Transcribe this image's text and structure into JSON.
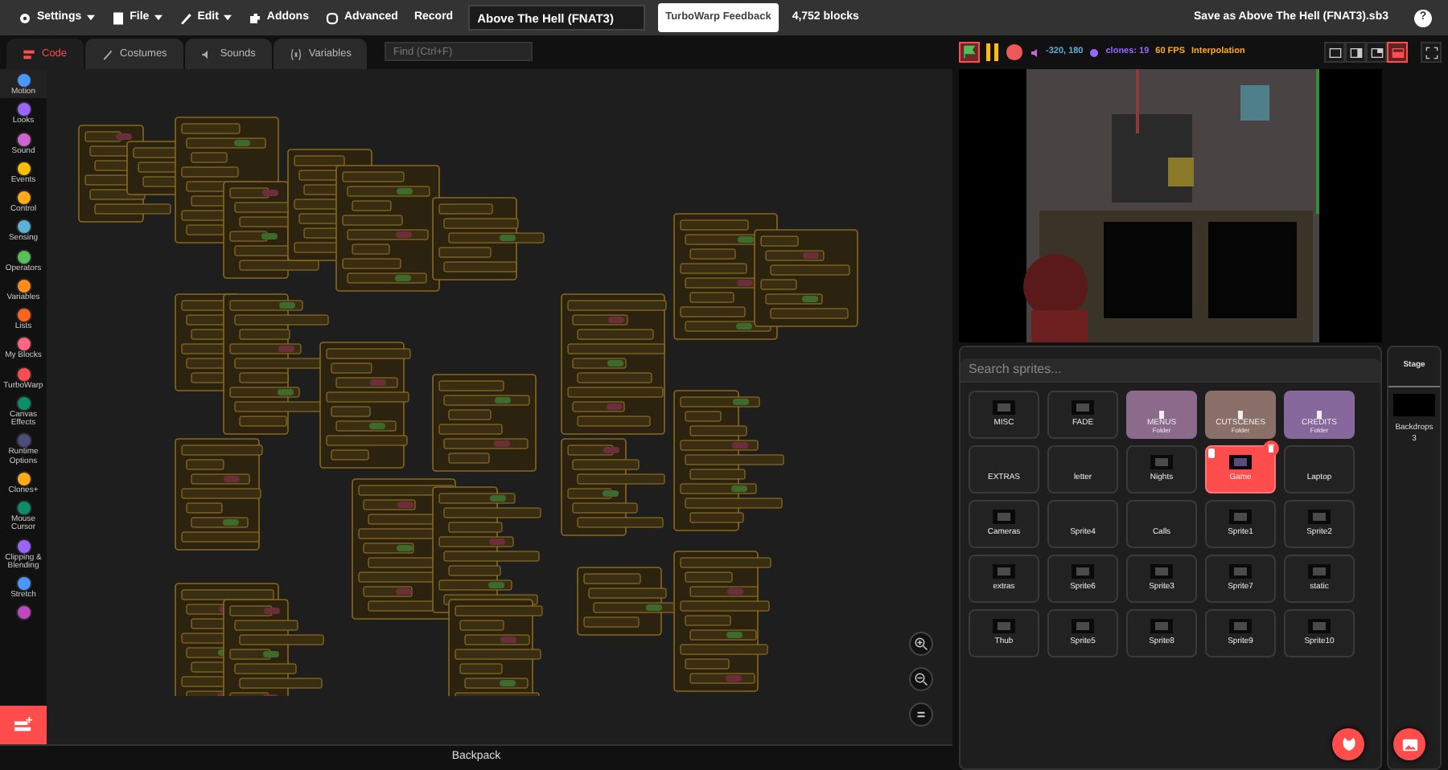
{
  "menu_bar": {
    "items": [
      {
        "label": "Settings",
        "dropdown": true
      },
      {
        "label": "File",
        "dropdown": true
      },
      {
        "label": "Edit",
        "dropdown": true
      },
      {
        "label": "Addons",
        "dropdown": false
      },
      {
        "label": "Advanced",
        "dropdown": false
      },
      {
        "label": "Record",
        "dropdown": false
      }
    ],
    "project_title": "Above The Hell (FNAT3)",
    "feedback_button": "TurboWarp Feedback",
    "block_count": "4,752 blocks",
    "save_label": "Save as Above The Hell (FNAT3).sb3",
    "help": "?"
  },
  "tabs": [
    {
      "label": "Code",
      "selected": true
    },
    {
      "label": "Costumes",
      "selected": false
    },
    {
      "label": "Sounds",
      "selected": false
    },
    {
      "label": "Variables",
      "selected": false
    }
  ],
  "find": {
    "placeholder": "Find (Ctrl+F)"
  },
  "categories": [
    {
      "label": "Motion",
      "color": "#4c97ff",
      "selected": true
    },
    {
      "label": "Looks",
      "color": "#9966ff",
      "selected": false
    },
    {
      "label": "Sound",
      "color": "#cf63cf",
      "selected": false
    },
    {
      "label": "Events",
      "color": "#ffbf00",
      "selected": false
    },
    {
      "label": "Control",
      "color": "#ffab19",
      "selected": false
    },
    {
      "label": "Sensing",
      "color": "#5cb1d6",
      "selected": false
    },
    {
      "label": "Operators",
      "color": "#59c059",
      "selected": false
    },
    {
      "label": "Variables",
      "color": "#ff8c1a",
      "selected": false
    },
    {
      "label": "Lists",
      "color": "#ff661a",
      "selected": false
    },
    {
      "label": "My Blocks",
      "color": "#ff6680",
      "selected": false
    },
    {
      "label": "TurboWarp",
      "color": "#ff4c4c",
      "selected": false
    },
    {
      "label": "Canvas Effects",
      "color": "#0b8e69",
      "selected": false
    },
    {
      "label": "Runtime Options",
      "color": "#4c4c7f",
      "selected": false
    },
    {
      "label": "Clones+",
      "color": "#ffab19",
      "selected": false
    },
    {
      "label": "Mouse Cursor",
      "color": "#0b8e69",
      "selected": false
    },
    {
      "label": "Clipping & Blending",
      "color": "#9966ff",
      "selected": false
    },
    {
      "label": "Stretch",
      "color": "#4c97ff",
      "selected": false
    },
    {
      "color": "#c047c0",
      "selected": false
    }
  ],
  "backpack": "Backpack",
  "stage_toolbar": {
    "position": "-320, 180",
    "clones": "clones: 19",
    "fps": "60 FPS",
    "interpolation": "Interpolation",
    "layouts": [
      {
        "selected": false
      },
      {
        "selected": false
      },
      {
        "selected": false
      },
      {
        "selected": true
      }
    ]
  },
  "sprite_search": {
    "placeholder": "Search sprites..."
  },
  "sprites": [
    {
      "name": "MISC",
      "kind": "sprite",
      "thumb": true,
      "selected": false
    },
    {
      "name": "FADE",
      "kind": "sprite",
      "thumb": true,
      "selected": false
    },
    {
      "name": "MENUS",
      "kind": "folder",
      "subtitle": "Folder",
      "color": "#8c6a8c",
      "selected": false
    },
    {
      "name": "CUTSCENES",
      "kind": "folder",
      "subtitle": "Folder",
      "color": "#8a7068",
      "selected": false
    },
    {
      "name": "CREDITS",
      "kind": "folder",
      "subtitle": "Folder",
      "color": "#86689c",
      "selected": false
    },
    {
      "name": "EXTRAS",
      "kind": "sprite",
      "thumb": false,
      "selected": false
    },
    {
      "name": "letter",
      "kind": "sprite",
      "thumb": false,
      "selected": false
    },
    {
      "name": "Nights",
      "kind": "sprite",
      "thumb": true,
      "selected": false
    },
    {
      "name": "Game",
      "kind": "sprite",
      "thumb": true,
      "selected": true
    },
    {
      "name": "Laptop",
      "kind": "sprite",
      "thumb": false,
      "selected": false
    },
    {
      "name": "Cameras",
      "kind": "sprite",
      "thumb": true,
      "selected": false
    },
    {
      "name": "Sprite4",
      "kind": "sprite",
      "thumb": false,
      "selected": false
    },
    {
      "name": "Calls",
      "kind": "sprite",
      "thumb": false,
      "selected": false
    },
    {
      "name": "Sprite1",
      "kind": "sprite",
      "thumb": true,
      "selected": false
    },
    {
      "name": "Sprite2",
      "kind": "sprite",
      "thumb": true,
      "selected": false
    },
    {
      "name": "extras",
      "kind": "sprite",
      "thumb": true,
      "selected": false
    },
    {
      "name": "Sprite6",
      "kind": "sprite",
      "thumb": true,
      "selected": false
    },
    {
      "name": "Sprite3",
      "kind": "sprite",
      "thumb": true,
      "selected": false
    },
    {
      "name": "Sprite7",
      "kind": "sprite",
      "thumb": true,
      "selected": false
    },
    {
      "name": "static",
      "kind": "sprite",
      "thumb": true,
      "selected": false
    },
    {
      "name": "Thub",
      "kind": "sprite",
      "thumb": true,
      "selected": false
    },
    {
      "name": "Sprite5",
      "kind": "sprite",
      "thumb": true,
      "selected": false
    },
    {
      "name": "Sprite8",
      "kind": "sprite",
      "thumb": true,
      "selected": false
    },
    {
      "name": "Sprite9",
      "kind": "sprite",
      "thumb": true,
      "selected": false
    },
    {
      "name": "Sprite10",
      "kind": "sprite",
      "thumb": true,
      "selected": false
    }
  ],
  "stage_panel": {
    "title": "Stage",
    "backdrops_label": "Backdrops",
    "backdrops_count": "3"
  }
}
